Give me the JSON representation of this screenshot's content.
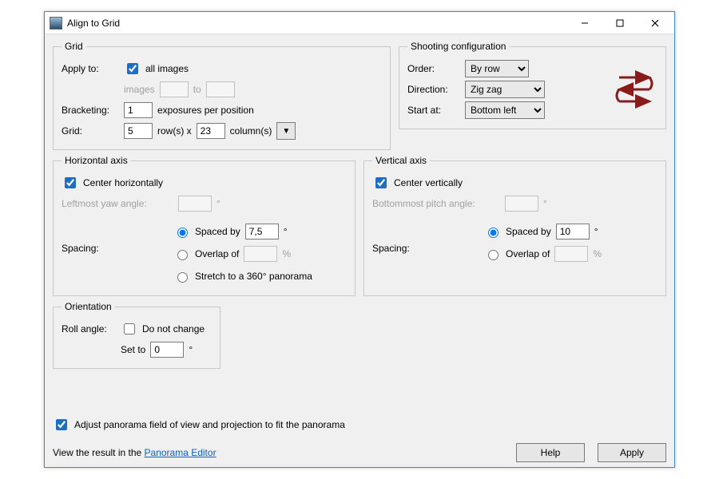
{
  "window": {
    "title": "Align to Grid"
  },
  "grid": {
    "legend": "Grid",
    "apply_to_label": "Apply to:",
    "all_images_label": "all images",
    "all_images": true,
    "images_label": "images",
    "to_label": "to",
    "images_from": "",
    "images_to": "",
    "bracketing_label": "Bracketing:",
    "bracketing_value": "1",
    "bracketing_suffix": "exposures per position",
    "grid_label": "Grid:",
    "rows": "5",
    "rows_x_label": "row(s) x",
    "cols": "23",
    "cols_label": "column(s)"
  },
  "shoot": {
    "legend": "Shooting configuration",
    "order_label": "Order:",
    "order_value": "By row",
    "direction_label": "Direction:",
    "direction_value": "Zig zag",
    "start_label": "Start at:",
    "start_value": "Bottom left"
  },
  "haxis": {
    "legend": "Horizontal axis",
    "center_label": "Center horizontally",
    "center": true,
    "leftmost_label": "Leftmost yaw angle:",
    "leftmost_value": "",
    "spacing_label": "Spacing:",
    "spaced_by_label": "Spaced by",
    "spaced_by_value": "7,5",
    "overlap_label": "Overlap of",
    "overlap_value": "",
    "stretch_label": "Stretch to a 360° panorama",
    "spacing_choice": "spaced"
  },
  "vaxis": {
    "legend": "Vertical axis",
    "center_label": "Center vertically",
    "center": true,
    "bottommost_label": "Bottommost pitch angle:",
    "bottommost_value": "",
    "spacing_label": "Spacing:",
    "spaced_by_label": "Spaced by",
    "spaced_by_value": "10",
    "overlap_label": "Overlap of",
    "overlap_value": "",
    "spacing_choice": "spaced"
  },
  "orient": {
    "legend": "Orientation",
    "roll_label": "Roll angle:",
    "dont_change_label": "Do not change",
    "dont_change": false,
    "set_to_label": "Set to",
    "value": "0"
  },
  "footer": {
    "adjust_label": "Adjust panorama field of view and projection to fit the panorama",
    "adjust": true,
    "view_result_prefix": "View the result in the ",
    "view_result_link": "Panorama Editor",
    "help_label": "Help",
    "apply_label": "Apply"
  }
}
